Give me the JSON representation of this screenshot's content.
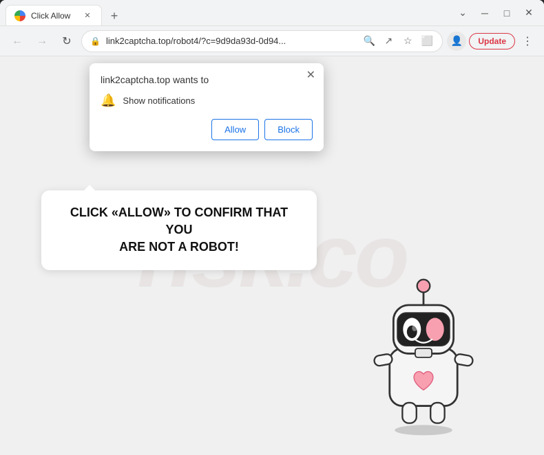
{
  "browser": {
    "tab": {
      "title": "Click Allow",
      "favicon_alt": "chrome-favicon"
    },
    "window_controls": {
      "minimize_label": "─",
      "maximize_label": "□",
      "close_label": "✕",
      "chevron_label": "⌄"
    },
    "new_tab_label": "+",
    "address_bar": {
      "url": "link2captcha.top/robot4/?c=9d9da93d-0d94...",
      "lock_icon": "🔒"
    },
    "nav": {
      "back_label": "←",
      "forward_label": "→",
      "reload_label": "↻"
    },
    "update_button_label": "Update",
    "menu_label": "⋮"
  },
  "notification_popup": {
    "title": "link2captcha.top wants to",
    "notification_row_label": "Show notifications",
    "allow_label": "Allow",
    "block_label": "Block",
    "close_label": "✕"
  },
  "page": {
    "message_line1": "CLICK «ALLOW» TO CONFIRM THAT YOU",
    "message_line2": "ARE NOT A ROBOT!",
    "watermark_text": "risk.co"
  }
}
